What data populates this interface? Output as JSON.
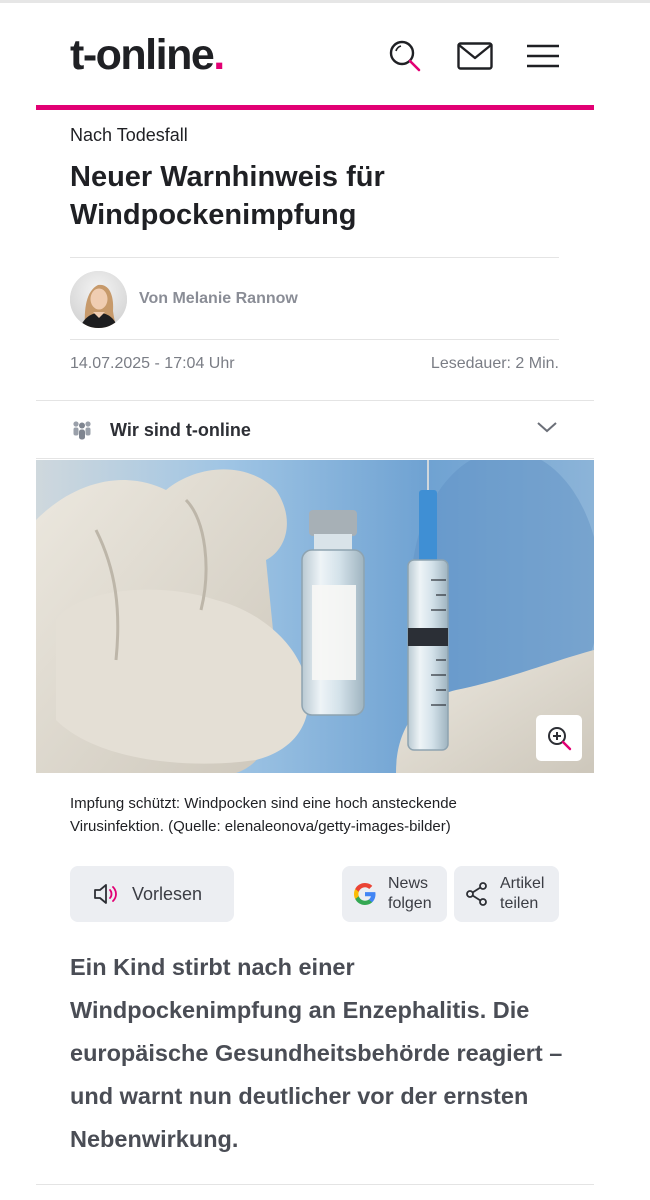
{
  "header": {
    "logo_text": "t-online",
    "logo_dot": ".",
    "brand_color": "#e20074",
    "icons": [
      "search-icon",
      "mail-icon",
      "menu-icon"
    ]
  },
  "article": {
    "kicker": "Nach Todesfall",
    "headline": "Neuer Warnhinweis für Windpockenimpfung",
    "author": "Von Melanie Rannow",
    "date": "14.07.2025 - 17:04 Uhr",
    "read_time": "Lesedauer: 2 Min.",
    "caption": "Impfung schützt: Windpocken sind eine hoch ansteckende Virusinfektion. (Quelle: elenaleonova/getty-images-bilder)",
    "lead": "Ein Kind stirbt nach einer Windpockenimpfung an Enzephalitis. Die europäische Gesundheitsbehörde reagiert – und warnt nun deutlicher vor der ernsten Nebenwirkung."
  },
  "about": {
    "label": "Wir sind t-online"
  },
  "actions": {
    "read_aloud": "Vorlesen",
    "news_follow": "News\nfolgen",
    "share": "Artikel\nteilen"
  }
}
